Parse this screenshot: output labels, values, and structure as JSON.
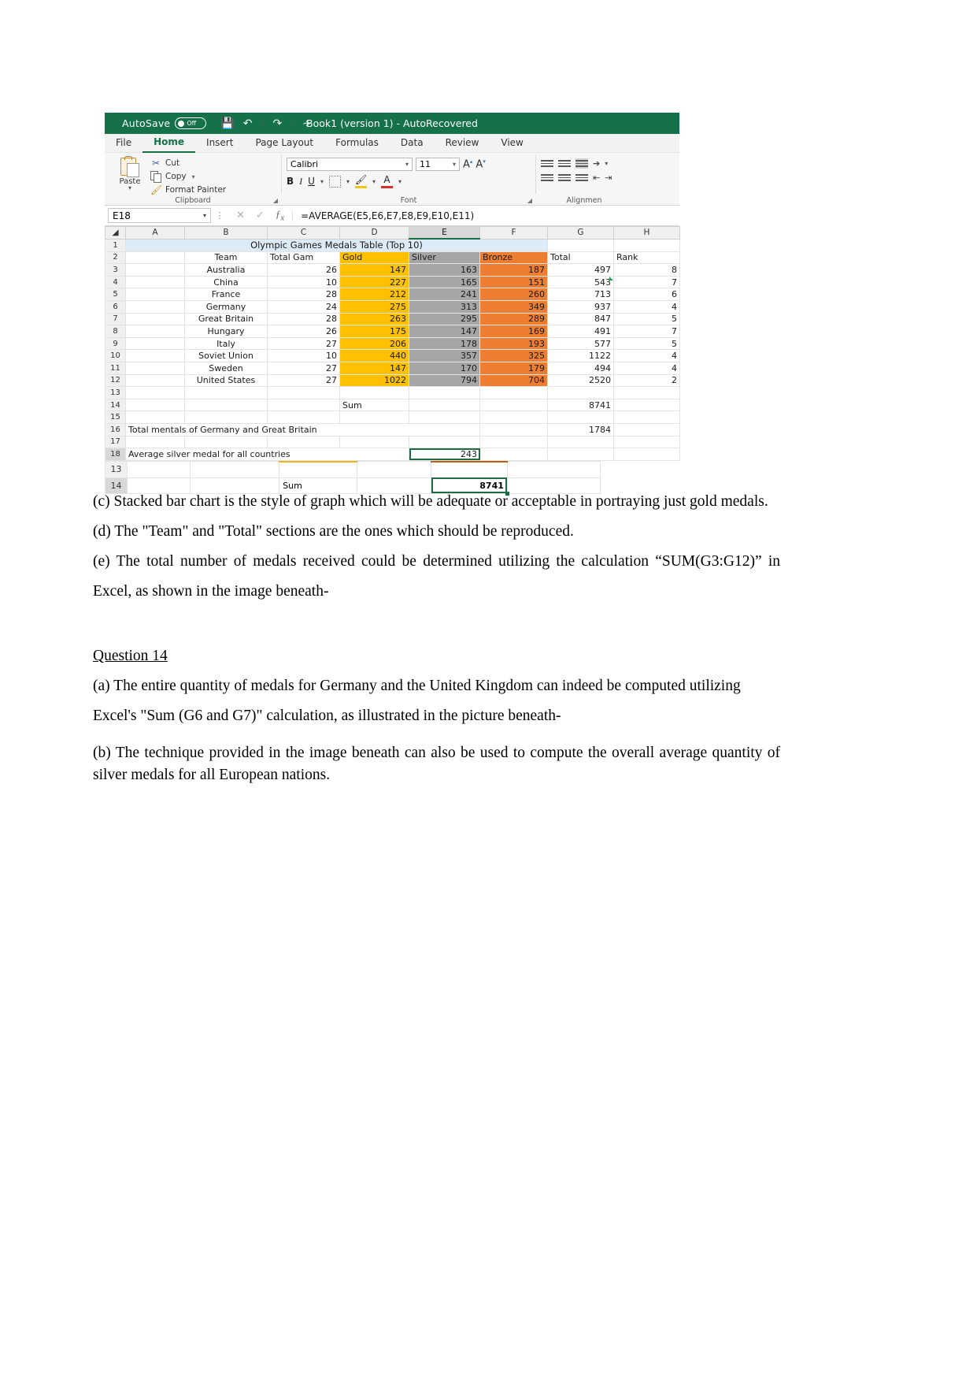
{
  "excel": {
    "titlebar": {
      "autosave_label": "AutoSave",
      "toggle_state": "Off",
      "save_icon": "save-icon",
      "undo_icon": "undo-icon",
      "redo_icon": "redo-icon",
      "customize_icon": "customize-qat-icon",
      "document_title": "Book1 (version 1)  -  AutoRecovered",
      "title_dropdown": "dropdown-caret"
    },
    "tabs": [
      {
        "label": "File",
        "active": false
      },
      {
        "label": "Home",
        "active": true
      },
      {
        "label": "Insert",
        "active": false
      },
      {
        "label": "Page Layout",
        "active": false
      },
      {
        "label": "Formulas",
        "active": false
      },
      {
        "label": "Data",
        "active": false
      },
      {
        "label": "Review",
        "active": false
      },
      {
        "label": "View",
        "active": false
      }
    ],
    "ribbon": {
      "clipboard": {
        "group_label": "Clipboard",
        "paste_label": "Paste",
        "cut_label": "Cut",
        "copy_label": "Copy",
        "format_painter_label": "Format Painter"
      },
      "font": {
        "group_label": "Font",
        "font_name": "Calibri",
        "font_size": "11",
        "grow_font": "A",
        "shrink_font": "A",
        "bold": "B",
        "italic": "I",
        "underline": "U",
        "fill_color": "A",
        "font_color": "A"
      },
      "alignment": {
        "group_label": "Alignmen"
      }
    },
    "formula_bar": {
      "name_box": "E18",
      "cancel_icon": "cancel-icon",
      "enter_icon": "confirm-icon",
      "function_icon": "fx",
      "formula": "=AVERAGE(E5,E6,E7,E8,E9,E10,E11)"
    },
    "grid": {
      "columns": [
        "A",
        "B",
        "C",
        "D",
        "E",
        "F",
        "G",
        "H"
      ],
      "selected_column": "E",
      "selected_row": "18",
      "title_row": {
        "row": "1",
        "text": "Olympic Games Medals Table (Top 10)"
      },
      "headers": {
        "row": "2",
        "team": "Team",
        "total_games": "Total Gam",
        "gold": "Gold",
        "silver": "Silver",
        "bronze": "Bronze",
        "total": "Total",
        "rank": "Rank"
      },
      "rows": [
        {
          "row": "3",
          "team": "Australia",
          "games": "26",
          "gold": "147",
          "silver": "163",
          "bronze": "187",
          "total": "497",
          "rank": "8"
        },
        {
          "row": "4",
          "team": "China",
          "games": "10",
          "gold": "227",
          "silver": "165",
          "bronze": "151",
          "total": "543",
          "rank": "7"
        },
        {
          "row": "5",
          "team": "France",
          "games": "28",
          "gold": "212",
          "silver": "241",
          "bronze": "260",
          "total": "713",
          "rank": "6"
        },
        {
          "row": "6",
          "team": "Germany",
          "games": "24",
          "gold": "275",
          "silver": "313",
          "bronze": "349",
          "total": "937",
          "rank": "4"
        },
        {
          "row": "7",
          "team": "Great Britain",
          "games": "28",
          "gold": "263",
          "silver": "295",
          "bronze": "289",
          "total": "847",
          "rank": "5"
        },
        {
          "row": "8",
          "team": "Hungary",
          "games": "26",
          "gold": "175",
          "silver": "147",
          "bronze": "169",
          "total": "491",
          "rank": "7"
        },
        {
          "row": "9",
          "team": "Italy",
          "games": "27",
          "gold": "206",
          "silver": "178",
          "bronze": "193",
          "total": "577",
          "rank": "5"
        },
        {
          "row": "10",
          "team": "Soviet Union",
          "games": "10",
          "gold": "440",
          "silver": "357",
          "bronze": "325",
          "total": "1122",
          "rank": "4"
        },
        {
          "row": "11",
          "team": "Sweden",
          "games": "27",
          "gold": "147",
          "silver": "170",
          "bronze": "179",
          "total": "494",
          "rank": "4"
        },
        {
          "row": "12",
          "team": "United States",
          "games": "27",
          "gold": "1022",
          "silver": "794",
          "bronze": "704",
          "total": "2520",
          "rank": "2"
        }
      ],
      "blank_rows": [
        "13",
        "15",
        "17"
      ],
      "sum_row": {
        "row": "14",
        "label": "Sum",
        "value": "8741"
      },
      "total_germany_gb_row": {
        "row": "16",
        "label": "Total mentals of Germany and Great Britain",
        "value": "1784"
      },
      "average_silver_row": {
        "row": "18",
        "label": "Average silver medal for all countries",
        "value": "243"
      }
    },
    "fragment": {
      "rows": [
        "13",
        "14"
      ],
      "sum_label": "Sum",
      "sum_value": "8741"
    }
  },
  "document": {
    "paragraphs": [
      "(c) Stacked bar chart is the style of graph which will be adequate or acceptable in portraying just gold medals.",
      "(d) The \"Team\" and \"Total\" sections are the ones which should be reproduced.",
      "(e) The total number of medals received could be determined utilizing the calculation “SUM(G3:G12)” in Excel, as shown in the image beneath-"
    ],
    "question_heading": "Question 14",
    "question_paragraphs": [
      "(a) The entire quantity of medals for Germany and the United Kingdom can indeed be computed utilizing Excel's \"Sum (G6 and G7)\" calculation, as illustrated in the picture beneath-",
      "(b)   The technique provided in the image beneath can also be used to compute the overall average quantity of silver medals for all European nations."
    ]
  },
  "colors": {
    "excel_green": "#14714a",
    "gold": "#ffc000",
    "silver": "#a6a6a6",
    "bronze": "#ed7d31",
    "title_fill": "#ddebf7",
    "selection": "#1f6b45"
  }
}
